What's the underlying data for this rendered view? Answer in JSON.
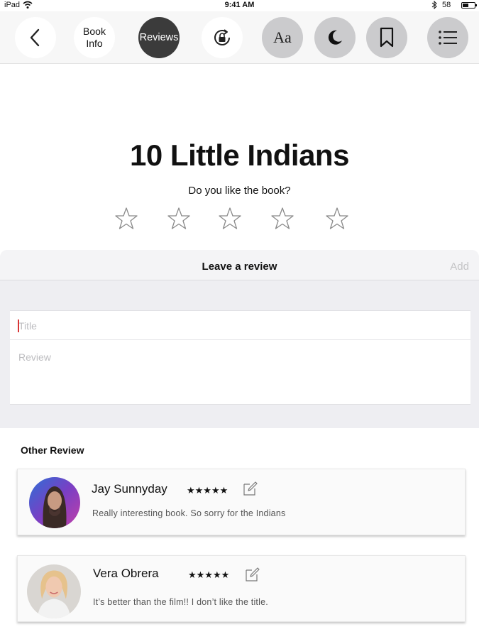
{
  "status_bar": {
    "device": "iPad",
    "time": "9:41 AM",
    "battery_percent": "58"
  },
  "toolbar": {
    "book_info_line1": "Book",
    "book_info_line2": "Info",
    "reviews_label": "Reviews",
    "font_label": "Aa"
  },
  "book": {
    "title": "10 Little Indians",
    "rating_prompt": "Do you like the book?",
    "rating_value": 0,
    "rating_max": 5
  },
  "review_form": {
    "header": "Leave a review",
    "add_label": "Add",
    "title_placeholder": "Title",
    "review_placeholder": "Review"
  },
  "other_reviews": {
    "heading": "Other Review",
    "items": [
      {
        "name": "Jay Sunnyday",
        "stars": "★★★★★",
        "rating": 5,
        "text": "Really interesting book. So sorry for the Indians"
      },
      {
        "name": "Vera Obrera",
        "stars": "★★★★★",
        "rating": 5,
        "text": "It’s better than the film!! I don’t like the title."
      }
    ]
  },
  "icons": {
    "back": "chevron-left-icon",
    "rotation_lock": "rotation-lock-icon",
    "night_mode": "moon-icon",
    "bookmark": "bookmark-icon",
    "contents": "list-icon",
    "edit": "edit-icon"
  },
  "colors": {
    "toolbar_bg": "#f7f7f7",
    "active_button": "#3b3b3b",
    "grey_button": "#cbcbcd",
    "sheet_bg": "#eeeef2",
    "caret": "#d93636"
  }
}
